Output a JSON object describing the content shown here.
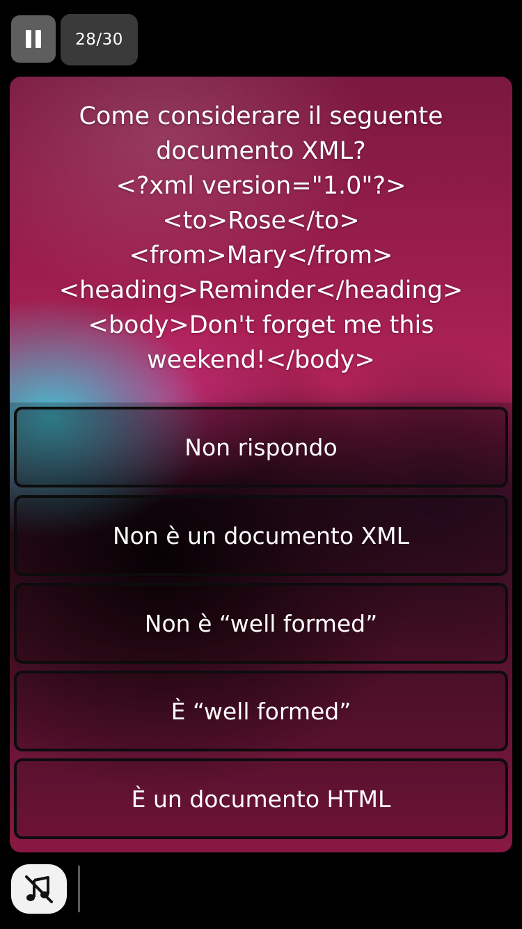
{
  "header": {
    "pause_icon": "pause-icon",
    "progress": {
      "current": "28",
      "separator": "/",
      "total": "30"
    }
  },
  "question": {
    "text": "Come considerare il seguente documento XML?\n<?xml version=\"1.0\"?>\n<to>Rose</to>\n<from>Mary</from>\n<heading>Reminder</heading>\n<body>Don't forget me this weekend!</body>"
  },
  "answers": [
    "Non rispondo",
    "Non è un documento XML",
    "Non è “well formed”",
    "È “well formed”",
    "È un documento HTML"
  ],
  "footer": {
    "music_icon": "music-off-icon"
  }
}
